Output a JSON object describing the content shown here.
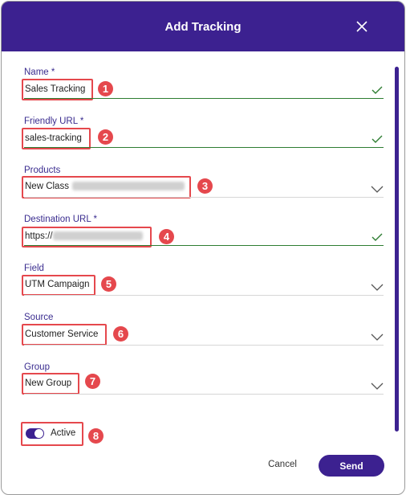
{
  "dialog": {
    "title": "Add Tracking",
    "accent": "#3c2190",
    "highlight": "#e5484d"
  },
  "fields": {
    "name": {
      "label": "Name *",
      "value": "Sales Tracking",
      "badge": "1"
    },
    "friendly_url": {
      "label": "Friendly URL *",
      "value": "sales-tracking",
      "badge": "2"
    },
    "products": {
      "label": "Products",
      "value": "New Class",
      "badge": "3"
    },
    "destination_url": {
      "label": "Destination URL *",
      "value": "https://",
      "badge": "4"
    },
    "field": {
      "label": "Field",
      "value": "UTM Campaign",
      "badge": "5"
    },
    "source": {
      "label": "Source",
      "value": "Customer Service",
      "badge": "6"
    },
    "group": {
      "label": "Group",
      "value": "New Group",
      "badge": "7"
    }
  },
  "toggle": {
    "label": "Active",
    "on": true,
    "badge": "8"
  },
  "footer": {
    "cancel_label": "Cancel",
    "send_label": "Send"
  }
}
